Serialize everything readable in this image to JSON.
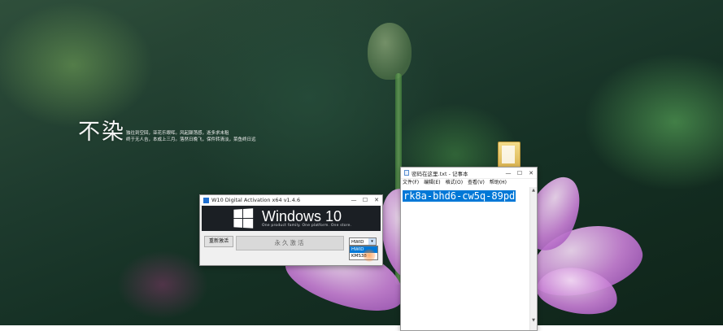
{
  "wallpaper": {
    "calligraphy_title": "不染",
    "calligraphy_lines": [
      "独往到空回，亚花乐眼晖。风起颠荡感，逝多求未租",
      "终于无人吉，本成上三月。落然日晚飞，保件转清淡，菜鱼终日远"
    ]
  },
  "activation_window": {
    "title": "W10 Digital Activation x64 v1.4.6",
    "minimize_glyph": "—",
    "maximize_glyph": "☐",
    "close_glyph": "✕",
    "banner_title": "Windows 10",
    "banner_subtitle": "One product family. One platform. One store.",
    "reset_button": "重新激活",
    "activate_button": "永久激活",
    "mode_selected": "HWID",
    "mode_options": [
      "HWID",
      "KMS38"
    ],
    "chevron_glyph": "▾"
  },
  "notepad": {
    "title": "密码在这里.txt - 记事本",
    "minimize_glyph": "—",
    "maximize_glyph": "☐",
    "close_glyph": "✕",
    "menu": [
      "文件(F)",
      "编辑(E)",
      "格式(O)",
      "查看(V)",
      "帮助(H)"
    ],
    "content": "rk8a-bhd6-cw5q-89pd",
    "scroll_up_glyph": "▲",
    "scroll_down_glyph": "▼"
  },
  "colors": {
    "selection": "#0078d7",
    "banner_bg": "#1b1f24",
    "window_bg": "#f0f0f0"
  }
}
